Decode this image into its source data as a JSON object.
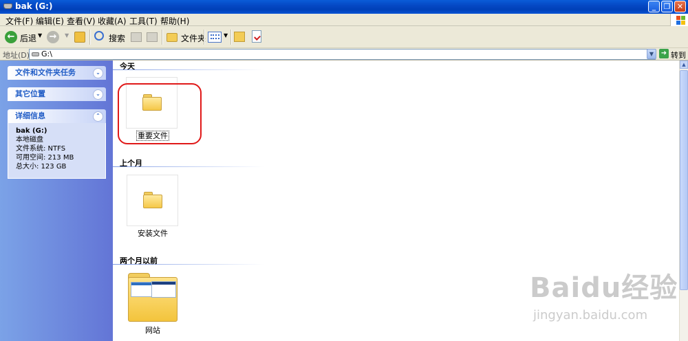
{
  "window": {
    "title": "bak (G:)",
    "min": "_",
    "max": "❐",
    "close": "✕"
  },
  "menu": [
    {
      "label": "文件(F)"
    },
    {
      "label": "编辑(E)"
    },
    {
      "label": "查看(V)"
    },
    {
      "label": "收藏(A)"
    },
    {
      "label": "工具(T)"
    },
    {
      "label": "帮助(H)"
    }
  ],
  "toolbar": {
    "back": "后退",
    "search": "搜索",
    "folders": "文件夹"
  },
  "address": {
    "label": "地址(D)",
    "value": "G:\\",
    "go": "转到"
  },
  "sidebar": {
    "panels": [
      {
        "title": "文件和文件夹任务",
        "state": "collapsed"
      },
      {
        "title": "其它位置",
        "state": "collapsed"
      },
      {
        "title": "详细信息",
        "state": "expanded"
      }
    ],
    "details": {
      "name": "bak (G:)",
      "type": "本地磁盘",
      "filesystem": "文件系统: NTFS",
      "free": "可用空间: 213 MB",
      "total": "总大小: 123 GB"
    }
  },
  "groups": [
    {
      "title": "今天",
      "items": [
        {
          "name": "重要文件",
          "selected": true,
          "highlight_color": "#e01818"
        }
      ]
    },
    {
      "title": "上个月",
      "items": [
        {
          "name": "安装文件"
        }
      ]
    },
    {
      "title": "两个月以前",
      "items": [
        {
          "name": "网站"
        }
      ]
    }
  ],
  "watermark": {
    "brand": "Baidu经验",
    "url": "jingyan.baidu.com"
  },
  "colors": {
    "titlebar": "#0548c4",
    "sidebar": "#6f8fdf",
    "accent": "#215dc6"
  }
}
